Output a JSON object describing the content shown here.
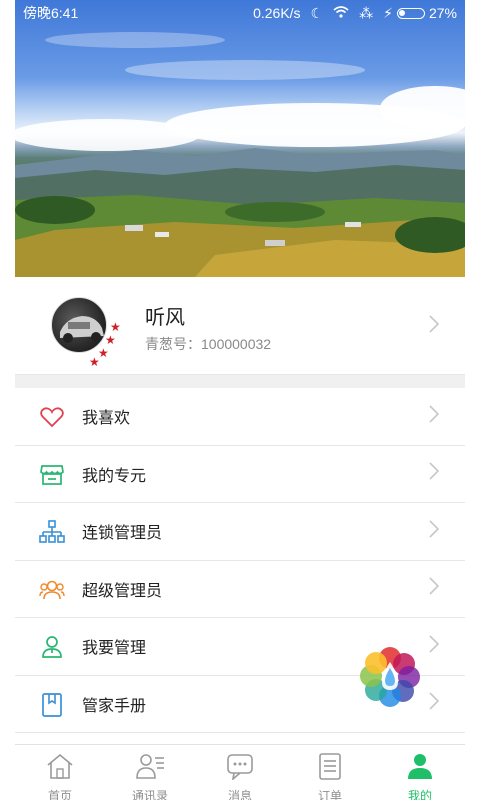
{
  "status_bar": {
    "time": "傍晚6:41",
    "network_speed": "0.26K/s",
    "battery_percent": "27%",
    "battery_level": 0.27
  },
  "profile": {
    "name": "听风",
    "id_text": "青葱号：100000032"
  },
  "menu": {
    "items": [
      {
        "label": "我喜欢",
        "icon": "heart-icon"
      },
      {
        "label": "我的专元",
        "icon": "shop-icon"
      },
      {
        "label": "连锁管理员",
        "icon": "org-chart-icon"
      },
      {
        "label": "超级管理员",
        "icon": "group-icon"
      },
      {
        "label": "我要管理",
        "icon": "user-manage-icon"
      },
      {
        "label": "管家手册",
        "icon": "book-icon"
      }
    ]
  },
  "tabbar": {
    "tabs": [
      {
        "label": "首页",
        "icon": "home-icon",
        "active": false
      },
      {
        "label": "通讯录",
        "icon": "contacts-icon",
        "active": false
      },
      {
        "label": "消息",
        "icon": "message-icon",
        "active": false
      },
      {
        "label": "订单",
        "icon": "order-icon",
        "active": false
      },
      {
        "label": "我的",
        "icon": "profile-icon",
        "active": true
      }
    ]
  },
  "colors": {
    "accent": "#1fbf6a",
    "heart": "#e0414e",
    "shop": "#2bb673",
    "org": "#3a8fd6",
    "group": "#f0892e",
    "manage": "#2bb673",
    "book": "#3a8fd6"
  }
}
